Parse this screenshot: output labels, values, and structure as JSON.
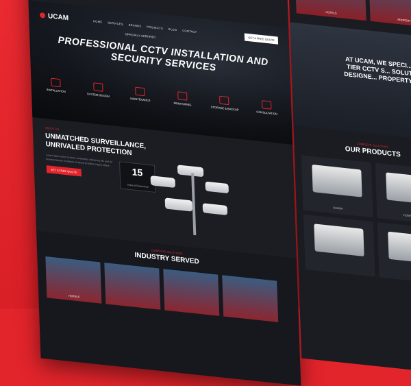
{
  "brand": {
    "name": "UCAM"
  },
  "nav": {
    "links": [
      "HOME",
      "SERVICES",
      "BRANDS",
      "PROJECTS",
      "BLOG",
      "CONTACT"
    ],
    "quote": "GET A FREE QUOTE"
  },
  "hero": {
    "subtitle": "OFFICIALLY CERTIFIED",
    "title": "PROFESSIONAL CCTV INSTALLATION AND SECURITY SERVICES",
    "services": [
      "INSTALLATION",
      "SYSTEM DESIGN",
      "MAINTENANCE",
      "MONITORING",
      "STORAGE & BACKUP",
      "CONSULTATION"
    ]
  },
  "about": {
    "tag": "ABOUT US",
    "title": "UNMATCHED SURVEILLANCE, UNRIVALED PROTECTION",
    "text": "Lorem ipsum dolor sit amet, consectetur adipiscing elit, sed do eiusmod tempor incididunt ut labore et dolore magna aliqua.",
    "button": "GET A FREE QUOTE",
    "years": "15",
    "years_label": "Years of Experience"
  },
  "industry": {
    "tag": "COMPLETE SOLUTIONS",
    "title": "INDUSTRY SERVED",
    "cards": [
      "HOTELS",
      "",
      "",
      ""
    ]
  },
  "right": {
    "cards": [
      "HOTELS",
      "PROPERTY"
    ],
    "hero_text": "AT UCAM, WE SPECI... TOP-TIER CCTV S... SOLUTIONS DESIGNE... PROPERTY SAFE",
    "products_tag": "COMPLETE SOLUTIONS",
    "products_title": "OUR PRODUCTS",
    "products": [
      "DAHUA",
      "HONEYWELL",
      "",
      ""
    ]
  }
}
